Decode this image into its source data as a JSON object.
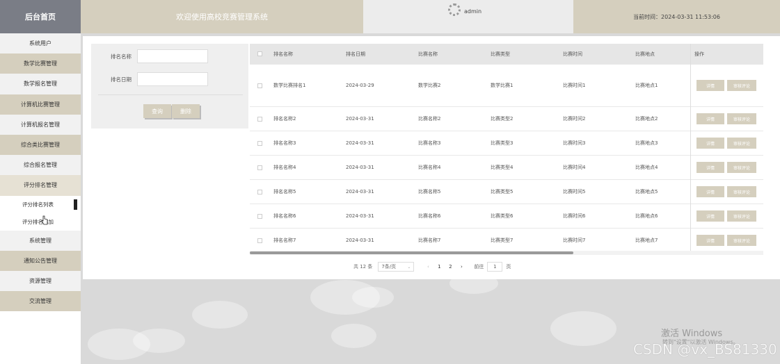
{
  "header": {
    "logo": "后台首页",
    "title": "欢迎使用高校竞赛管理系统",
    "user": "admin",
    "time": "当前时间：2024-03-31 11:53:06",
    "colors": {
      "accent": "#d5cfbe",
      "logo_bg": "#7a7d86"
    }
  },
  "sidebar": {
    "items": [
      {
        "label": "系统用户"
      },
      {
        "label": "数学比赛管理"
      },
      {
        "label": "数学报名管理"
      },
      {
        "label": "计算机比赛管理"
      },
      {
        "label": "计算机报名管理"
      },
      {
        "label": "综合类比赛管理"
      },
      {
        "label": "综合报名管理"
      },
      {
        "label": "评分排名管理"
      },
      {
        "label": "系统管理"
      },
      {
        "label": "通知公告管理"
      },
      {
        "label": "资源管理"
      },
      {
        "label": "交流管理"
      }
    ],
    "subitems": [
      {
        "label": "评分排名列表"
      },
      {
        "label": "评分排名添加"
      }
    ]
  },
  "search": {
    "name_label": "排名名称",
    "date_label": "排名日期",
    "query_btn": "查询",
    "delete_btn": "删除"
  },
  "table": {
    "headers": [
      "排名名称",
      "排名日期",
      "比赛名称",
      "比赛类型",
      "比赛时间",
      "比赛地点",
      "操作"
    ],
    "detail_btn": "详情",
    "review_btn": "审核评论",
    "rows": [
      [
        "数学比赛排名1",
        "2024-03-29",
        "数学比赛2",
        "数学比赛1",
        "比赛时间1",
        "比赛地点1"
      ],
      [
        "排名名称2",
        "2024-03-31",
        "比赛名称2",
        "比赛类型2",
        "比赛时间2",
        "比赛地点2"
      ],
      [
        "排名名称3",
        "2024-03-31",
        "比赛名称3",
        "比赛类型3",
        "比赛时间3",
        "比赛地点3"
      ],
      [
        "排名名称4",
        "2024-03-31",
        "比赛名称4",
        "比赛类型4",
        "比赛时间4",
        "比赛地点4"
      ],
      [
        "排名名称5",
        "2024-03-31",
        "比赛名称5",
        "比赛类型5",
        "比赛时间5",
        "比赛地点5"
      ],
      [
        "排名名称6",
        "2024-03-31",
        "比赛名称6",
        "比赛类型6",
        "比赛时间6",
        "比赛地点6"
      ],
      [
        "排名名称7",
        "2024-03-31",
        "比赛名称7",
        "比赛类型7",
        "比赛时间7",
        "比赛地点7"
      ]
    ]
  },
  "pagination": {
    "total": "共 12 条",
    "page_size": "7条/页",
    "prev": "‹",
    "next": "›",
    "pages": [
      "1",
      "2"
    ],
    "goto_label": "前往",
    "goto_value": "1",
    "page_unit": "页"
  },
  "watermark": {
    "title": "激活 Windows",
    "subtitle": "转到\"设置\"以激活 Windows。",
    "csdn": "CSDN @vx_BS81330"
  }
}
